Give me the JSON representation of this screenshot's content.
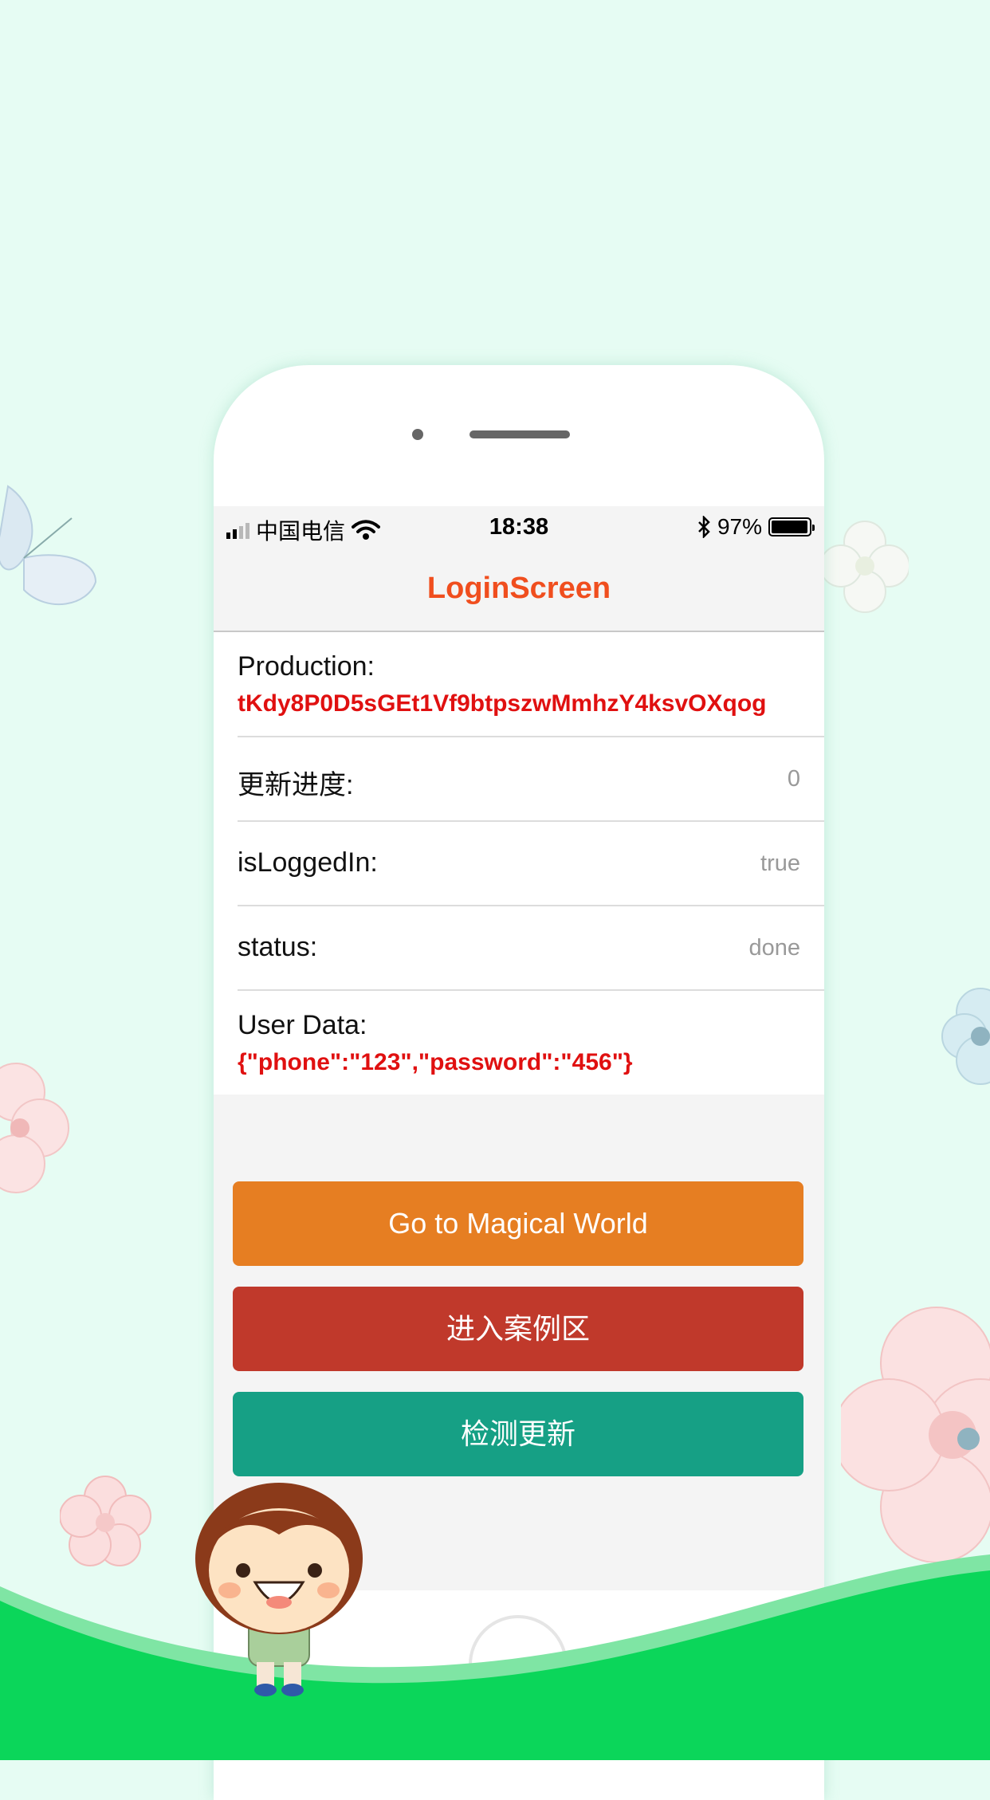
{
  "status_bar": {
    "carrier": "中国电信",
    "time": "18:38",
    "battery": "97%",
    "battery_level": 0.97
  },
  "nav": {
    "title": "LoginScreen"
  },
  "rows": {
    "production": {
      "label": "Production:",
      "value": "tKdy8P0D5sGEt1Vf9btpszwMmhzY4ksvOXqog"
    },
    "progress": {
      "label": "更新进度:",
      "value": "0"
    },
    "logged_in": {
      "label": "isLoggedIn:",
      "value": "true"
    },
    "status": {
      "label": "status:",
      "value": "done"
    },
    "user_data": {
      "label": "User Data:",
      "value": "{\"phone\":\"123\",\"password\":\"456\"}"
    }
  },
  "buttons": {
    "magical": "Go to Magical World",
    "cases": "进入案例区",
    "update": "检测更新"
  },
  "colors": {
    "title": "#f04e1e",
    "value_red": "#e01010",
    "btn_orange": "#e67e22",
    "btn_red": "#c0392b",
    "btn_teal": "#16a085",
    "background": "#e6fcf3",
    "grass": "#0bd65a"
  },
  "icons": [
    "signal-icon",
    "wifi-icon",
    "bluetooth-icon",
    "battery-icon",
    "butterfly-icon",
    "flower-icon",
    "boy-character-icon"
  ]
}
